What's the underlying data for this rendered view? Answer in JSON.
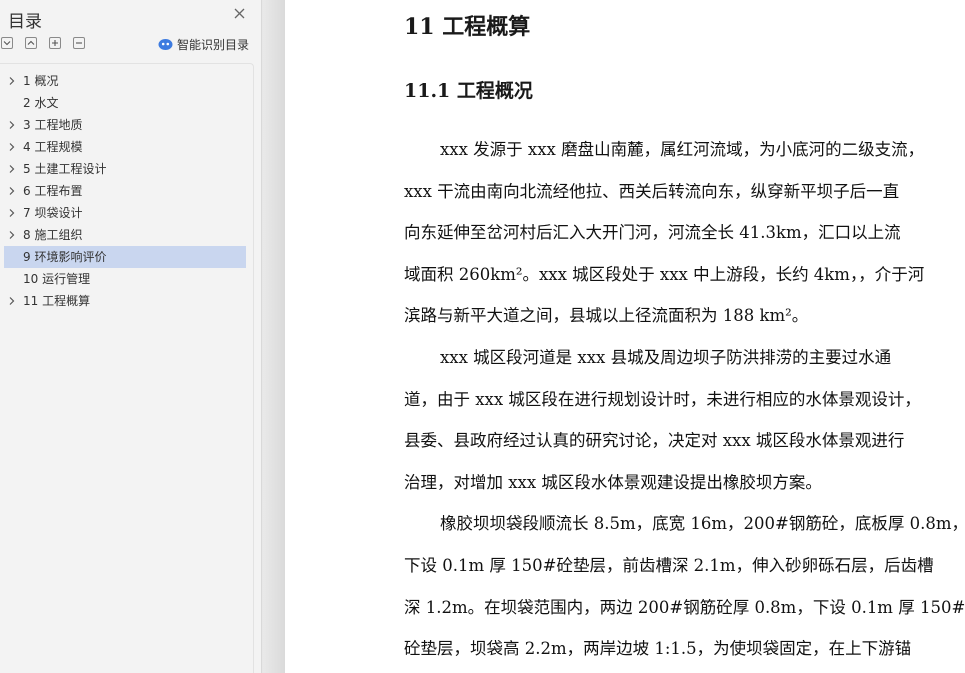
{
  "sidebar": {
    "title": "目录",
    "smart_toc_label": "智能识别目录",
    "toc": [
      {
        "label": "1 概况",
        "expandable": true
      },
      {
        "label": "2 水文",
        "expandable": false
      },
      {
        "label": "3 工程地质",
        "expandable": true
      },
      {
        "label": "4  工程规模",
        "expandable": true
      },
      {
        "label": "5 土建工程设计",
        "expandable": true
      },
      {
        "label": "6 工程布置",
        "expandable": true
      },
      {
        "label": "7  坝袋设计",
        "expandable": true
      },
      {
        "label": "8 施工组织",
        "expandable": true
      },
      {
        "label": "9 环境影响评价",
        "expandable": false,
        "selected": true
      },
      {
        "label": "10  运行管理",
        "expandable": false
      },
      {
        "label": "11 工程概算",
        "expandable": true
      }
    ]
  },
  "document": {
    "heading1": "11 工程概算",
    "heading2": "11.1  工程概况",
    "lines": [
      "xxx 发源于 xxx 磨盘山南麓，属红河流域，为小底河的二级支流，",
      "xxx 干流由南向北流经他拉、西关后转流向东，纵穿新平坝子后一直",
      "向东延伸至岔河村后汇入大开门河，河流全长 41.3km，汇口以上流",
      "域面积 260km²。xxx 城区段处于 xxx 中上游段，长约 4km，，介于河",
      "滨路与新平大道之间，县城以上径流面积为 188 km²。",
      "xxx 城区段河道是 xxx 县城及周边坝子防洪排涝的主要过水通",
      "道，由于 xxx 城区段在进行规划设计时，未进行相应的水体景观设计，",
      "县委、县政府经过认真的研究讨论，决定对 xxx 城区段水体景观进行",
      "治理，对增加 xxx 城区段水体景观建设提出橡胶坝方案。",
      "橡胶坝坝袋段顺流长 8.5m，底宽 16m，200#钢筋砼，底板厚 0.8m，",
      "下设 0.1m 厚 150#砼垫层，前齿槽深 2.1m，伸入砂卵砾石层，后齿槽",
      "深 1.2m。在坝袋范围内，两边 200#钢筋砼厚 0.8m，下设 0.1m 厚 150#",
      "砼垫层，坝袋高 2.2m，两岸边坡 1:1.5，为使坝袋固定，在上下游锚"
    ]
  },
  "colors": {
    "sidebar_bg": "#f3f3f3",
    "selected_item": "#c9d6ef",
    "smart_icon": "#3d7be0"
  }
}
